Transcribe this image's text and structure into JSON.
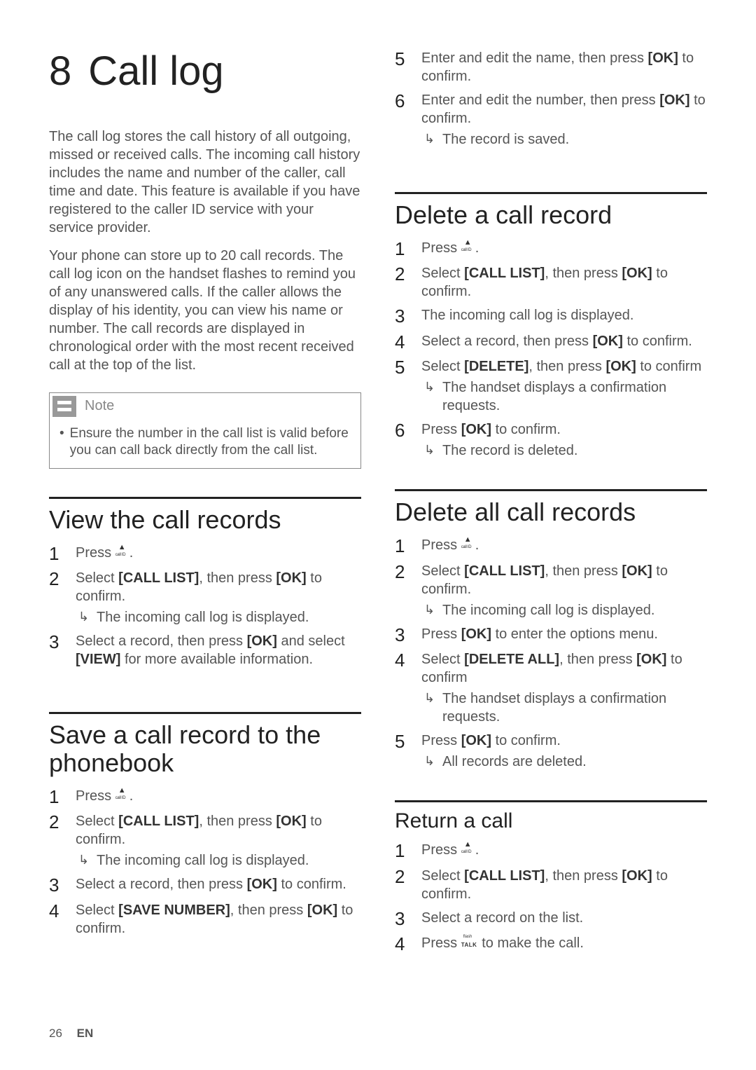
{
  "chapter": {
    "number": "8",
    "title": "Call log"
  },
  "intro": {
    "p1": "The call log stores the call history of all outgoing, missed or received calls. The incoming call history includes the name and number of the caller, call time and date. This feature is available if you have registered to the caller ID service with your service provider.",
    "p2": "Your phone can store up to 20 call records. The call log icon on the handset flashes to remind you of any unanswered calls. If the caller allows the display of his identity, you can view his name or number. The call records are displayed in chronological order with the most recent received call at the top of the list."
  },
  "note": {
    "label": "Note",
    "text": "Ensure the number in the call list is valid before you can call back directly from the call list."
  },
  "view": {
    "title": "View the call records",
    "s1a": "Press ",
    "s1b": ".",
    "s2a": "Select ",
    "s2b": "[CALL LIST]",
    "s2c": ", then press ",
    "s2d": "[OK]",
    "s2e": " to confirm.",
    "s2r": "The incoming call log is displayed.",
    "s3a": "Select a record, then press ",
    "s3b": "[OK]",
    "s3c": " and select ",
    "s3d": "[VIEW]",
    "s3e": " for more available information."
  },
  "save": {
    "title": "Save a call record to the phonebook",
    "s1a": "Press ",
    "s1b": ".",
    "s2a": "Select ",
    "s2b": "[CALL LIST]",
    "s2c": ", then press ",
    "s2d": "[OK]",
    "s2e": " to confirm.",
    "s2r": "The incoming call log is displayed.",
    "s3a": "Select a record, then press ",
    "s3b": "[OK]",
    "s3c": " to confirm.",
    "s4a": "Select ",
    "s4b": "[SAVE NUMBER]",
    "s4c": ", then press ",
    "s4d": "[OK]",
    "s4e": " to confirm.",
    "s5a": "Enter and edit the name, then press ",
    "s5b": "[OK]",
    "s5c": " to confirm.",
    "s6a": "Enter and edit the number, then press ",
    "s6b": "[OK]",
    "s6c": " to confirm.",
    "s6r": "The record is saved."
  },
  "del_one": {
    "title": "Delete a call record",
    "s1a": "Press ",
    "s1b": ".",
    "s2a": "Select ",
    "s2b": "[CALL LIST]",
    "s2c": ", then press ",
    "s2d": "[OK]",
    "s2e": " to confirm.",
    "s3": "The incoming call log is displayed.",
    "s4a": "Select a record, then press ",
    "s4b": "[OK]",
    "s4c": " to confirm.",
    "s5a": "Select ",
    "s5b": "[DELETE]",
    "s5c": ", then press ",
    "s5d": "[OK]",
    "s5e": " to confirm",
    "s5r": "The handset displays a confirmation requests.",
    "s6a": "Press ",
    "s6b": "[OK]",
    "s6c": " to confirm.",
    "s6r": "The record is deleted."
  },
  "del_all": {
    "title": "Delete all call records",
    "s1a": "Press ",
    "s1b": ".",
    "s2a": "Select ",
    "s2b": "[CALL LIST]",
    "s2c": ", then press ",
    "s2d": "[OK]",
    "s2e": " to confirm.",
    "s2r": "The incoming call log is displayed.",
    "s3a": "Press ",
    "s3b": "[OK]",
    "s3c": " to enter the options menu.",
    "s4a": "Select ",
    "s4b": "[DELETE ALL]",
    "s4c": ", then press ",
    "s4d": "[OK]",
    "s4e": " to confirm",
    "s4r": "The handset displays a confirmation requests.",
    "s5a": "Press ",
    "s5b": "[OK]",
    "s5c": " to confirm.",
    "s5r": "All records are deleted."
  },
  "return": {
    "title": "Return a call",
    "s1a": "Press ",
    "s1b": ".",
    "s2a": "Select ",
    "s2b": "[CALL LIST]",
    "s2c": ", then press ",
    "s2d": "[OK]",
    "s2e": " to confirm.",
    "s3": "Select a record on the list.",
    "s4a": "Press ",
    "s4b": " to make the call."
  },
  "footer": {
    "page": "26",
    "lang": "EN"
  }
}
